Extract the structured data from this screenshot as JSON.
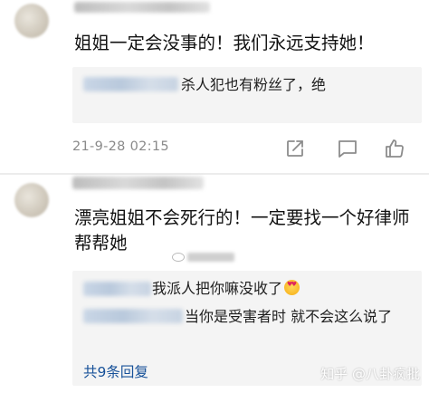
{
  "comments": [
    {
      "text": "姐姐一定会没事的！我们永远支持她！",
      "replies": [
        {
          "text": "杀人犯也有粉丝了，绝"
        }
      ],
      "time": "21-9-28 02:15"
    },
    {
      "text": "漂亮姐姐不会死行的！一定要找一个好律师帮帮她",
      "replies": [
        {
          "text": "我派人把你嘛没收了"
        },
        {
          "text": "当你是受害者时 就不会这么说了"
        }
      ],
      "more_replies": "共9条回复",
      "zhihu_watermark": "知乎 @八卦疯批"
    }
  ],
  "icons": {
    "share": "share-icon",
    "comment": "comment-icon",
    "like": "thumbs-up-icon",
    "emoji": "heart-eyes-emoji-icon"
  },
  "colors": {
    "link": "#175199",
    "meta": "#8a8a8a",
    "reply_bg": "#f4f4f4"
  }
}
